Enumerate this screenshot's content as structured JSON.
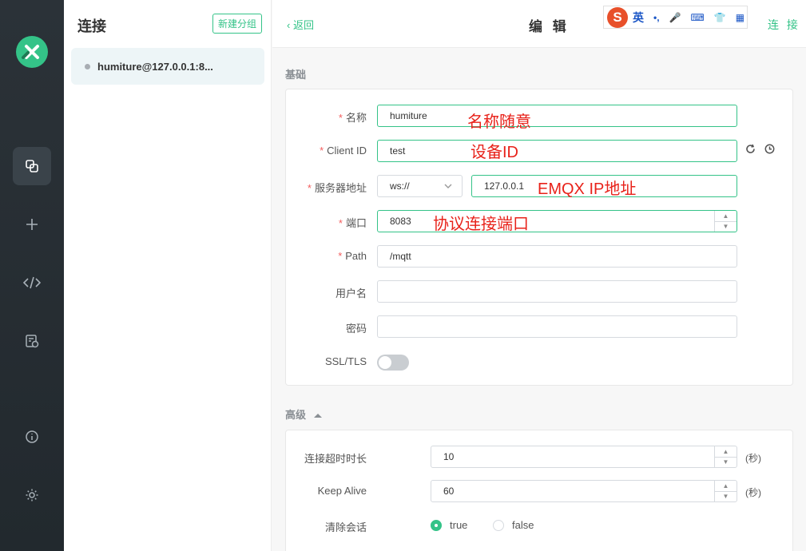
{
  "nav": {
    "items": [
      {
        "name": "connections",
        "icon": "copy-icon",
        "active": true
      },
      {
        "name": "new",
        "icon": "plus-icon"
      },
      {
        "name": "script",
        "icon": "code-icon"
      },
      {
        "name": "log",
        "icon": "log-icon"
      },
      {
        "name": "about",
        "icon": "info-icon"
      },
      {
        "name": "settings",
        "icon": "gear-icon"
      }
    ]
  },
  "connections": {
    "title": "连接",
    "new_group_label": "新建分组",
    "items": [
      {
        "name": "humiture@127.0.0.1:8...",
        "status": "disconnected"
      }
    ]
  },
  "header": {
    "back_label": "返回",
    "title": "编 辑",
    "connect_label": "连 接"
  },
  "ime": {
    "logo": "S",
    "mode": "英",
    "glyphs": [
      "•,",
      "🎤",
      "⌨",
      "👕",
      "▦"
    ]
  },
  "basic": {
    "section_label": "基础",
    "name": {
      "label": "名称",
      "value": "humiture",
      "annotation": "名称随意"
    },
    "client_id": {
      "label": "Client ID",
      "value": "test",
      "annotation": "设备ID"
    },
    "host": {
      "label": "服务器地址",
      "protocol": "ws://",
      "value": "127.0.0.1",
      "annotation": "EMQX IP地址"
    },
    "port": {
      "label": "端口",
      "value": "8083",
      "annotation": "协议连接端口"
    },
    "path": {
      "label": "Path",
      "value": "/mqtt"
    },
    "username": {
      "label": "用户名",
      "value": ""
    },
    "password": {
      "label": "密码",
      "value": ""
    },
    "ssl": {
      "label": "SSL/TLS",
      "enabled": false
    }
  },
  "advanced": {
    "section_label": "高级",
    "connect_timeout": {
      "label": "连接超时时长",
      "value": "10",
      "unit": "(秒)"
    },
    "keep_alive": {
      "label": "Keep Alive",
      "value": "60",
      "unit": "(秒)"
    },
    "clean_session": {
      "label": "清除会话",
      "options": [
        "true",
        "false"
      ],
      "selected": "true"
    }
  },
  "colors": {
    "accent": "#34c388",
    "required": "#f35e5e",
    "annotation": "#e8221a"
  }
}
